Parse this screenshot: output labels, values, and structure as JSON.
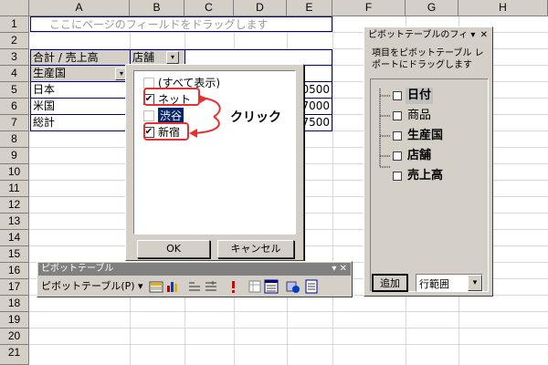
{
  "columns": [
    "A",
    "B",
    "C",
    "D",
    "E",
    "F",
    "G",
    "H"
  ],
  "rows": [
    "1",
    "2",
    "3",
    "4",
    "5",
    "6",
    "7",
    "8",
    "9",
    "10",
    "11",
    "12",
    "13",
    "14",
    "15",
    "16",
    "17",
    "18",
    "19",
    "20",
    "21"
  ],
  "sheet": {
    "page_drop_hint": "ここにページのフィールドをドラッグします",
    "pivot_corner": "合計 / 売上高",
    "col_field": "店舗",
    "row_field": "生産国",
    "total_header": "計",
    "row_labels": [
      "日本",
      "米国",
      "総計"
    ],
    "totals": [
      "0500",
      "7000",
      "7500"
    ]
  },
  "dropdown": {
    "items": [
      {
        "label": "(すべて表示)",
        "checked": false,
        "selected": false
      },
      {
        "label": "ネット",
        "checked": true,
        "selected": false
      },
      {
        "label": "渋谷",
        "checked": false,
        "selected": true
      },
      {
        "label": "新宿",
        "checked": true,
        "selected": false
      }
    ],
    "ok_label": "OK",
    "cancel_label": "キャンセル",
    "check_mark": "✔"
  },
  "annotation": {
    "text": "クリック",
    "color": "#e53030"
  },
  "field_list": {
    "title": "ピボットテーブルのフィ ▾",
    "close": "✕",
    "hint_line1": "項目をピボットテーブル レ",
    "hint_line2": "ポートにドラッグします",
    "fields": [
      "日付",
      "商品",
      "生産国",
      "店舗",
      "売上高"
    ],
    "add_button": "追加",
    "area_select": "行範囲",
    "area_arrow": "▾"
  },
  "toolbar": {
    "title": "ピボットテーブル",
    "menu_label": "ピボットテーブル(P) ▾",
    "controls": "▾ ✕",
    "icons": [
      "format-report-icon",
      "chart-wizard-icon",
      "hide-detail-icon",
      "show-detail-icon",
      "refresh-icon",
      "field-settings-icon",
      "field-list-icon",
      "table-options-icon",
      "show-items-icon"
    ]
  },
  "colors": {
    "selection": "#0a246a",
    "window": "#d4d0c8",
    "accent_red": "#e53030",
    "pivot_border": "#000080"
  }
}
